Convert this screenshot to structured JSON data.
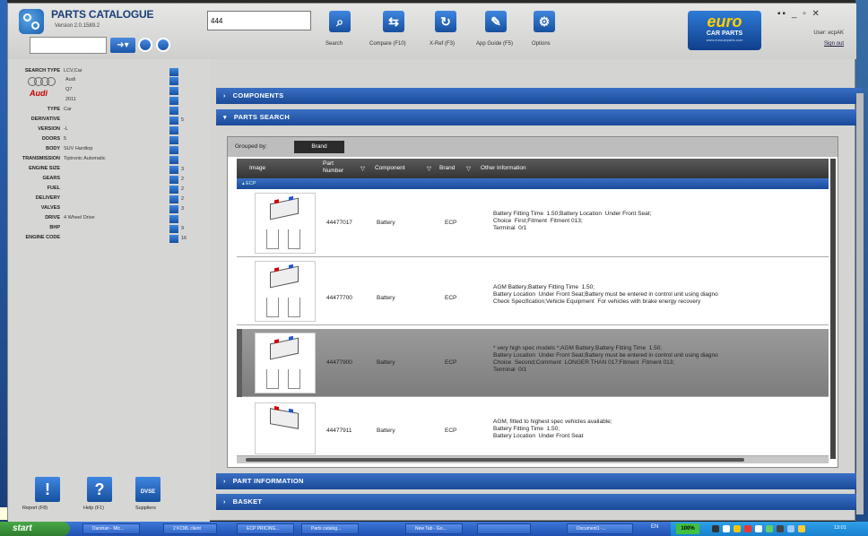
{
  "app": {
    "title": "PARTS CATALOGUE",
    "version": "Version 2.0.1589.2"
  },
  "search": {
    "value": "444",
    "left_value": ""
  },
  "toolbar": [
    {
      "label": "Search",
      "icon": "search-icon",
      "glyph": "⌕"
    },
    {
      "label": "Compare (F10)",
      "icon": "compare-icon",
      "glyph": "⇆"
    },
    {
      "label": "X-Ref (F3)",
      "icon": "refresh-icon",
      "glyph": "↻"
    },
    {
      "label": "App Guide (F5)",
      "icon": "wrench-icon",
      "glyph": "✎"
    },
    {
      "label": "Options",
      "icon": "gear-icon",
      "glyph": "⚙"
    }
  ],
  "brand": {
    "name": "euro",
    "sub": "CAR PARTS",
    "url": "www.eurocarparts.com"
  },
  "user": {
    "label": "User: ecpAK",
    "signout": "Sign out"
  },
  "window_controls": "▪▪ _ ▫ ✕",
  "filters": [
    {
      "label": "SEARCH TYPE",
      "value": "LCV,Car",
      "count": ""
    },
    {
      "label": "",
      "value": "Audi",
      "count": ""
    },
    {
      "label": "",
      "value": "Q7",
      "count": ""
    },
    {
      "label": "",
      "value": "2011",
      "count": ""
    },
    {
      "label": "TYPE",
      "value": "Car",
      "count": ""
    },
    {
      "label": "DERIVATIVE",
      "value": "",
      "count": "5"
    },
    {
      "label": "VERSION",
      "value": "-L",
      "count": ""
    },
    {
      "label": "DOORS",
      "value": "5",
      "count": ""
    },
    {
      "label": "BODY",
      "value": "SUV Hardtop",
      "count": ""
    },
    {
      "label": "TRANSMISSION",
      "value": "Tiptronic Automatic",
      "count": ""
    },
    {
      "label": "ENGINE SIZE",
      "value": "",
      "count": "3"
    },
    {
      "label": "GEARS",
      "value": "",
      "count": "2"
    },
    {
      "label": "FUEL",
      "value": "",
      "count": "2"
    },
    {
      "label": "DELIVERY",
      "value": "",
      "count": "2"
    },
    {
      "label": "VALVES",
      "value": "",
      "count": "3"
    },
    {
      "label": "DRIVE",
      "value": "4 Wheel Drive",
      "count": ""
    },
    {
      "label": "BHP",
      "value": "",
      "count": "9"
    },
    {
      "label": "ENGINE CODE",
      "value": "",
      "count": "16"
    }
  ],
  "make_logo": "Audi",
  "bottom_buttons": [
    {
      "label": "Report (F8)",
      "glyph": "!"
    },
    {
      "label": "Help (F1)",
      "glyph": "?"
    },
    {
      "label": "Suppliers",
      "glyph": "DVSE"
    }
  ],
  "sections": {
    "components": "COMPONENTS",
    "parts_search": "PARTS SEARCH",
    "part_information": "PART INFORMATION",
    "basket": "BASKET"
  },
  "grid": {
    "grouped_by_label": "Grouped by:",
    "grouped_by_value": "Brand",
    "columns": [
      "Image",
      "Part Number",
      "Component",
      "Brand",
      "Other Information"
    ],
    "group_name": "ECP",
    "rows": [
      {
        "part_number": "44477017",
        "component": "Battery",
        "brand": "ECP",
        "info": "Battery Fitting Time  1.50;Battery Location  Under Front Seat;\nChoice  First;Fitment  Fitment 013;\nTerminal  0/1",
        "selected": false
      },
      {
        "part_number": "44477700",
        "component": "Battery",
        "brand": "ECP",
        "info": "AGM Battery;Battery Fitting Time  1.50;\nBattery Location  Under Front Seat;Battery must be entered in control unit using diagno\nCheck Specification;Vehicle Equipment  For vehicles with brake energy recovery",
        "selected": false
      },
      {
        "part_number": "44477900",
        "component": "Battery",
        "brand": "ECP",
        "info": "* very high spec models *;AGM Battery;Battery Fitting Time  1.50;\nBattery Location  Under Front Seat;Battery must be entered in control unit using diagno\nChoice  Second;Comment  LONGER THAN 017;Fitment  Fitment 013;\nTerminal  0/1",
        "selected": true
      },
      {
        "part_number": "44477911",
        "component": "Battery",
        "brand": "ECP",
        "info": "AGM, fitted to highest spec vehicles available;\nBattery Fitting Time  1.50;\nBattery Location  Under Front Seat",
        "selected": false
      }
    ]
  },
  "taskbar": {
    "start": "start",
    "tasks": [
      "Darshan - Mic...",
      "2 KCML client",
      "ECP PRICING...",
      "Parts catalog...",
      "New Tab - Go...",
      "",
      "Document1 -..."
    ],
    "lang": "EN",
    "zoom": "100%",
    "clock": "13:01"
  }
}
